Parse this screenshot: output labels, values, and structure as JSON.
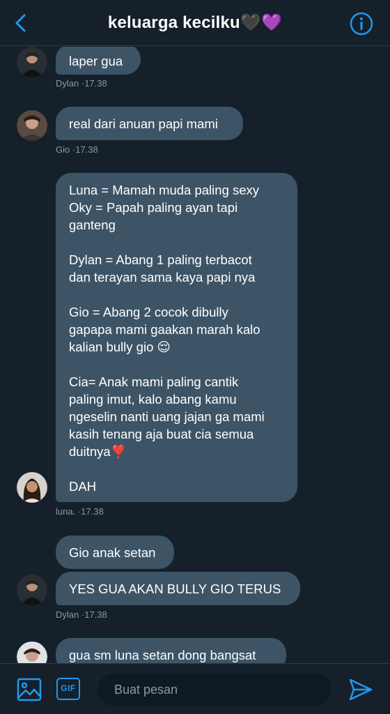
{
  "header": {
    "title": "keluarga kecilku🖤💜",
    "back_icon": "chevron-left-icon",
    "info_icon": "info-circle-icon"
  },
  "colors": {
    "background": "#15202b",
    "bubble": "#3d5466",
    "accent": "#1d9bf0",
    "meta": "#8899a6"
  },
  "messages": [
    {
      "text": "laper gua",
      "author": "Dylan",
      "time": "17.38"
    },
    {
      "text": "real dari anuan papi mami",
      "author": "Gio",
      "time": "17.38"
    },
    {
      "text": "Luna = Mamah muda paling sexy\nOky = Papah paling ayan tapi\nganteng\n\nDylan = Abang 1 paling terbacot\ndan terayan sama kaya papi nya\n\nGio = Abang 2 cocok dibully\ngapapa mami gaakan marah kalo\nkalian bully gio 😌\n\nCia= Anak mami paling cantik\npaling imut, kalo abang kamu\nngeselin nanti uang jajan ga mami\nkasih tenang aja buat cia semua\nduitnya❣️\n\nDAH",
      "author": "luna.",
      "time": "17.38"
    },
    {
      "text": "Gio anak setan",
      "author": "",
      "time": ""
    },
    {
      "text": "YES GUA AKAN BULLY GIO TERUS",
      "author": "Dylan",
      "time": "17.38"
    },
    {
      "text": "gua sm luna setan dong bangsat",
      "author": "",
      "time": ""
    }
  ],
  "composer": {
    "placeholder": "Buat pesan",
    "image_icon": "image-icon",
    "gif_label": "GIF",
    "send_icon": "send-icon"
  }
}
